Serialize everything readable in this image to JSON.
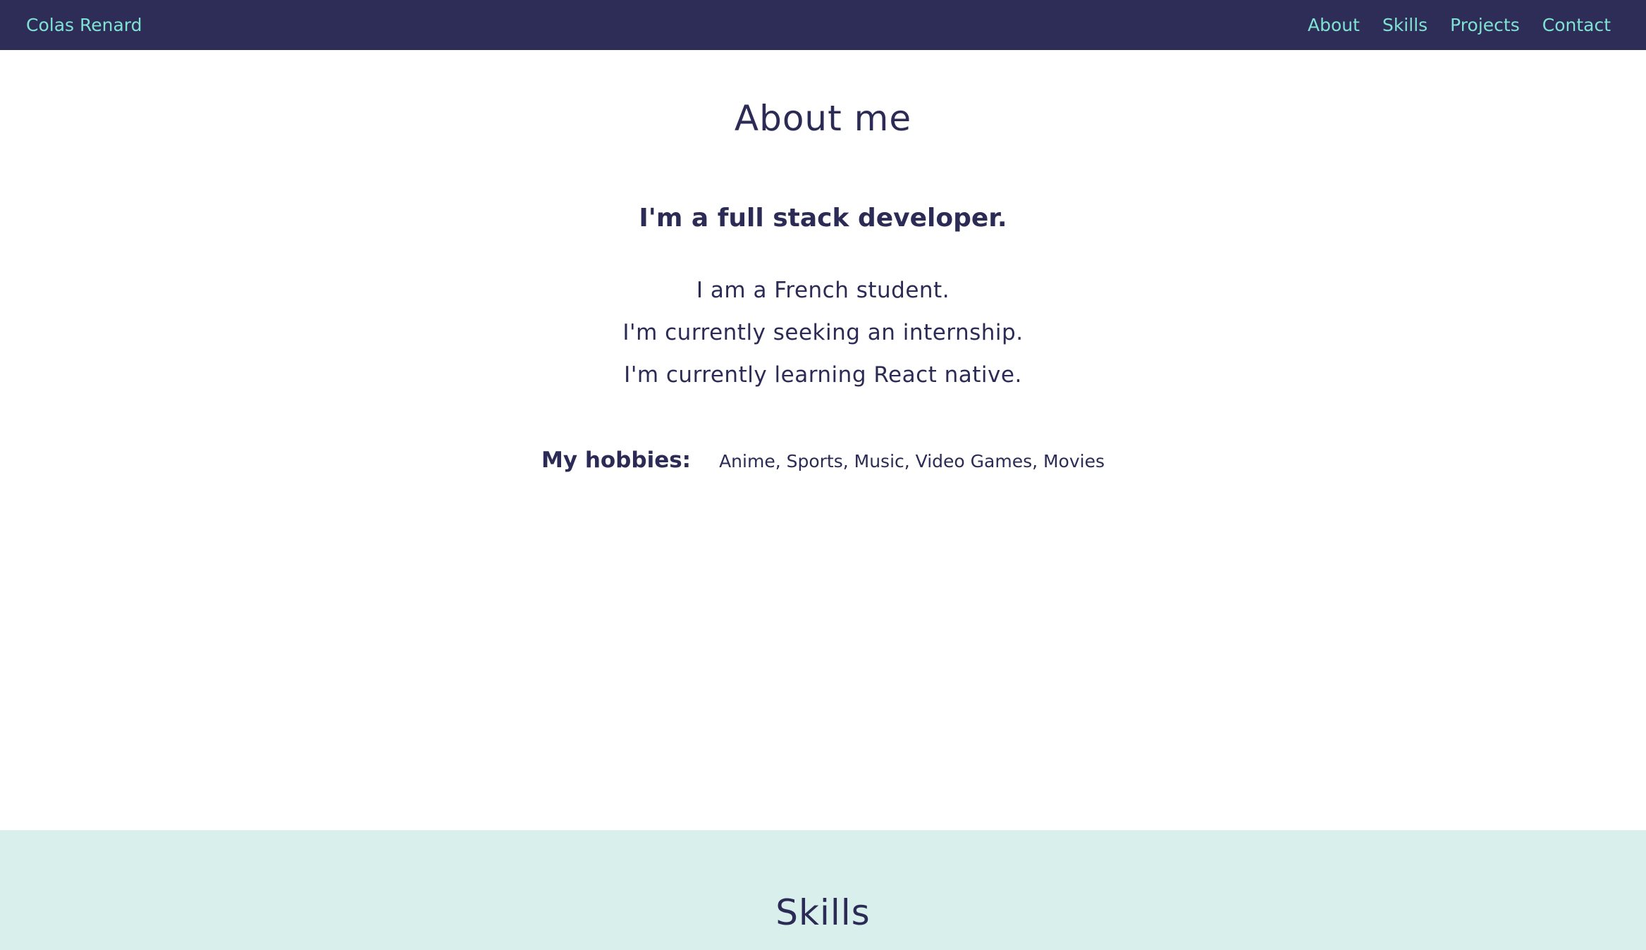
{
  "nav": {
    "brand": "Colas Renard",
    "links": [
      "About",
      "Skills",
      "Projects",
      "Contact"
    ]
  },
  "about": {
    "title": "About me",
    "tagline": "I'm a full stack developer.",
    "bio": [
      "I am a French student.",
      "I'm currently seeking an internship.",
      "I'm currently learning React native."
    ],
    "hobbies_label": "My hobbies:",
    "hobbies": "Anime, Sports, Music, Video Games, Movies"
  },
  "skills": {
    "title": "Skills"
  },
  "colors": {
    "navbar_bg": "#2e2d57",
    "nav_text": "#7fe3d3",
    "text_primary": "#2b2b55",
    "skills_bg": "#d8efec"
  }
}
